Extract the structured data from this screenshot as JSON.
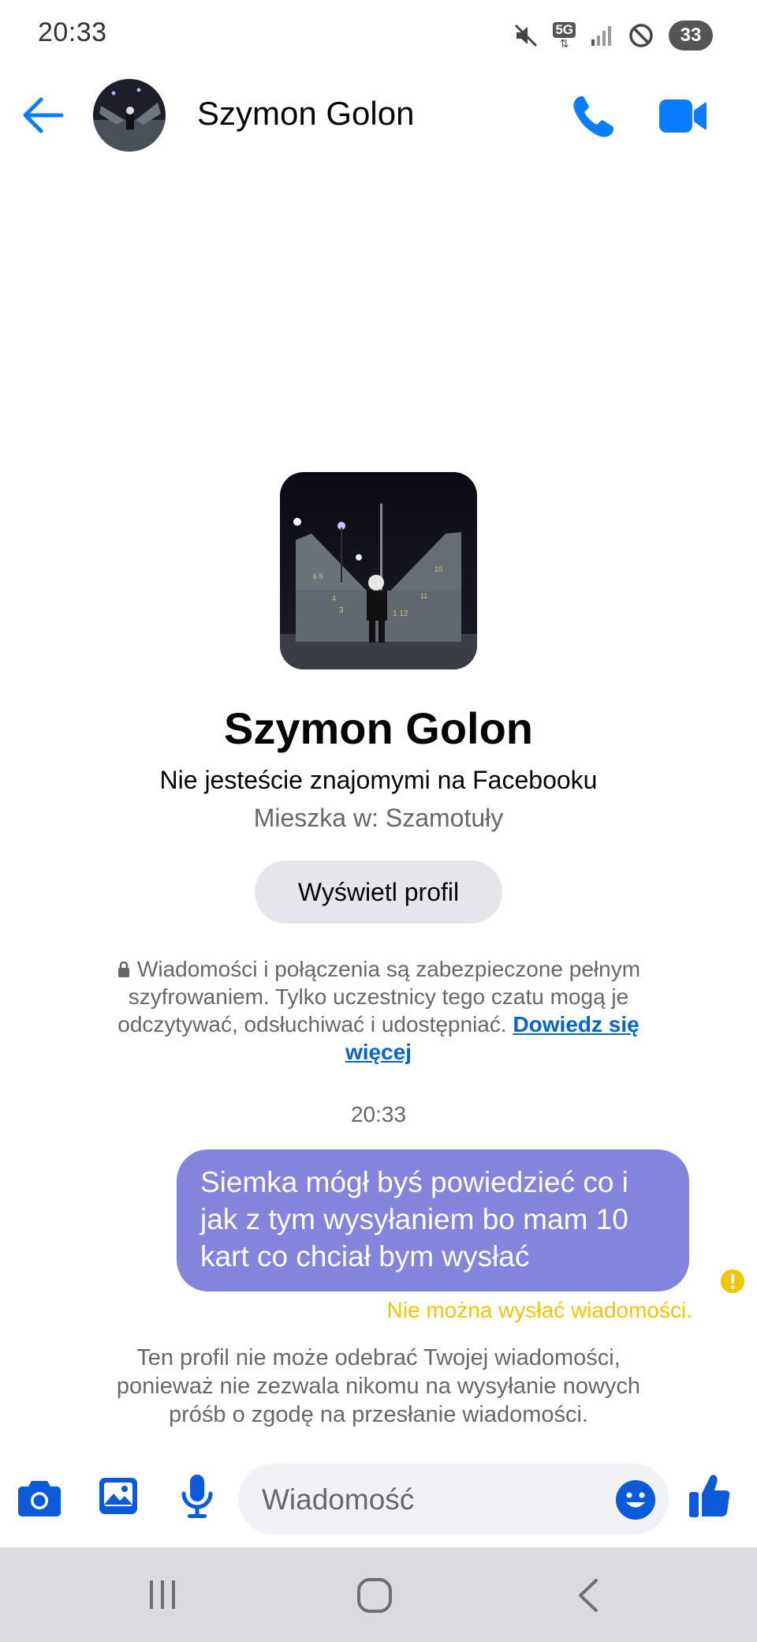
{
  "status_bar": {
    "time": "20:33",
    "network": "5G",
    "battery": "33",
    "icons": [
      "mute-icon",
      "5g-icon",
      "signal-icon",
      "do-not-disturb-icon",
      "battery-icon"
    ]
  },
  "header": {
    "contact_name": "Szymon Golon",
    "back_icon": "back-arrow-icon",
    "call_icon": "phone-icon",
    "video_icon": "video-camera-icon"
  },
  "profile": {
    "name": "Szymon Golon",
    "relationship": "Nie jesteście znajomymi na Facebooku",
    "location": "Mieszka w: Szamotuły",
    "view_profile_label": "Wyświetl profil"
  },
  "encryption_notice": {
    "text": "Wiadomości i połączenia są zabezpieczone pełnym szyfrowaniem. Tylko uczestnicy tego czatu mogą je odczytywać, odsłuchiwać i udostępniać.",
    "link": "Dowiedz się więcej"
  },
  "conversation": {
    "timestamp": "20:33",
    "message": "Siemka mógł byś powiedzieć co i jak z tym wysyłaniem bo mam 10 kart co chciał bym wysłać",
    "error": "Nie można wysłać wiadomości.",
    "blocked_notice": "Ten profil nie może odebrać Twojej wiadomości, ponieważ nie zezwala nikomu na wysyłanie nowych próśb o zgodę na przesłanie wiadomości."
  },
  "composer": {
    "placeholder": "Wiadomość",
    "icons": [
      "camera-icon",
      "gallery-icon",
      "microphone-icon",
      "emoji-icon",
      "thumbs-up-icon"
    ]
  },
  "nav_bar": {
    "icons": [
      "recents-icon",
      "home-icon",
      "back-icon"
    ]
  },
  "colors": {
    "accent": "#0a7cff",
    "bubble": "#8384dc",
    "error": "#f5c400",
    "link": "#0064d1",
    "secondary_text": "#65676b"
  }
}
